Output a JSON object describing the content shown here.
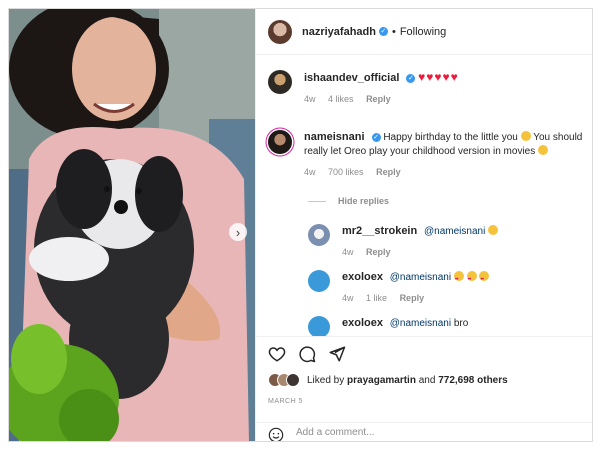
{
  "post": {
    "author": "nazriyafahadh",
    "follow_status": "Following",
    "separator": "•"
  },
  "comments": [
    {
      "username": "ishaandev_official",
      "text": "",
      "hearts": "♥♥♥♥♥",
      "time": "4w",
      "likes": "4 likes",
      "reply_label": "Reply"
    },
    {
      "username": "nameisnani",
      "text_part1": "Happy birthday to the little you",
      "text_part2": "You should really let Oreo play your childhood version in movies",
      "time": "4w",
      "likes": "700 likes",
      "reply_label": "Reply"
    }
  ],
  "hide_replies_label": "Hide replies",
  "replies": [
    {
      "username": "mr2__strokein",
      "mention": "@nameisnani",
      "time": "4w",
      "likes": "",
      "reply_label": "Reply"
    },
    {
      "username": "exoloex",
      "mention": "@nameisnani",
      "time": "4w",
      "likes": "1 like",
      "reply_label": "Reply"
    },
    {
      "username": "exoloex",
      "mention": "@nameisnani",
      "text": "bro"
    }
  ],
  "likes": {
    "prefix": "Liked by",
    "user": "prayagamartin",
    "joiner": "and",
    "count": "772,698 others"
  },
  "date": "MARCH 5",
  "add_comment": {
    "placeholder": "Add a comment..."
  },
  "colors": {
    "verified": "#3897f0",
    "heart": "#ed1c3c",
    "secondary_text": "#8e8e8e"
  },
  "icons": [
    "verified-icon",
    "heart-icon",
    "comment-icon",
    "share-icon",
    "emoji-icon",
    "chevron-right-icon"
  ]
}
